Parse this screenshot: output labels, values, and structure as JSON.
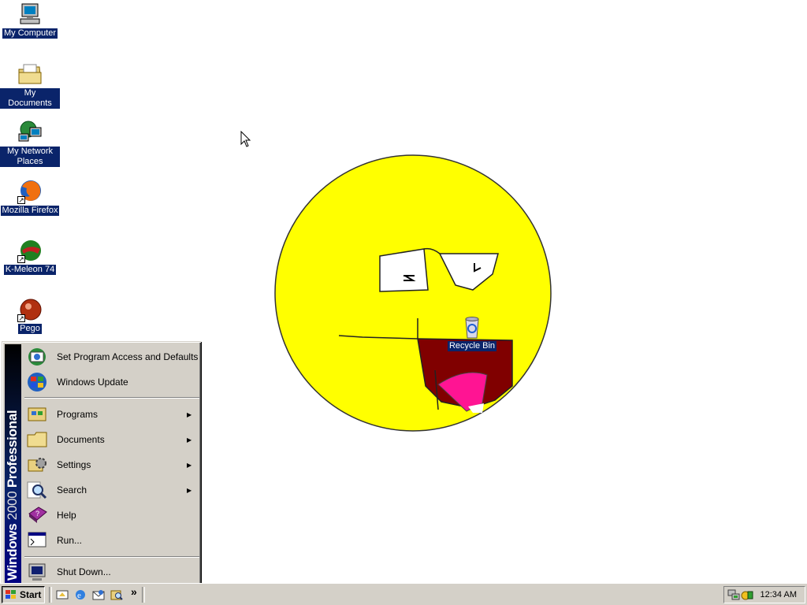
{
  "desktop": {
    "icons": [
      {
        "label": "My Computer"
      },
      {
        "label": "My Documents"
      },
      {
        "label": "My Network Places"
      },
      {
        "label": "Mozilla Firefox"
      },
      {
        "label": "K-Meleon 74"
      },
      {
        "label": "Pego"
      },
      {
        "label": "Recycle Bin"
      }
    ],
    "wallpaper_colors": {
      "face": "#ffff00",
      "mouth": "#800000",
      "tongue": "#ff1493"
    }
  },
  "start_menu": {
    "banner": {
      "part1": "Windows",
      "part2": "2000",
      "part3": "Professional"
    },
    "items": [
      {
        "label": "Set Program Access and Defaults",
        "icon": "program-access-icon"
      },
      {
        "label": "Windows Update",
        "icon": "windows-update-icon"
      },
      {
        "label": "Programs",
        "icon": "programs-icon",
        "submenu": true
      },
      {
        "label": "Documents",
        "icon": "documents-folder-icon",
        "submenu": true
      },
      {
        "label": "Settings",
        "icon": "settings-icon",
        "submenu": true
      },
      {
        "label": "Search",
        "icon": "search-icon",
        "submenu": true
      },
      {
        "label": "Help",
        "icon": "help-book-icon"
      },
      {
        "label": "Run...",
        "icon": "run-icon"
      },
      {
        "label": "Shut Down...",
        "icon": "shutdown-icon"
      }
    ]
  },
  "taskbar": {
    "start_label": "Start",
    "quick_launch_more": "»",
    "clock": "12:34 AM"
  },
  "colors": {
    "desktop_bg": "#ffffff",
    "face_bg": "#d4d0c8",
    "selection": "#0a246a"
  }
}
